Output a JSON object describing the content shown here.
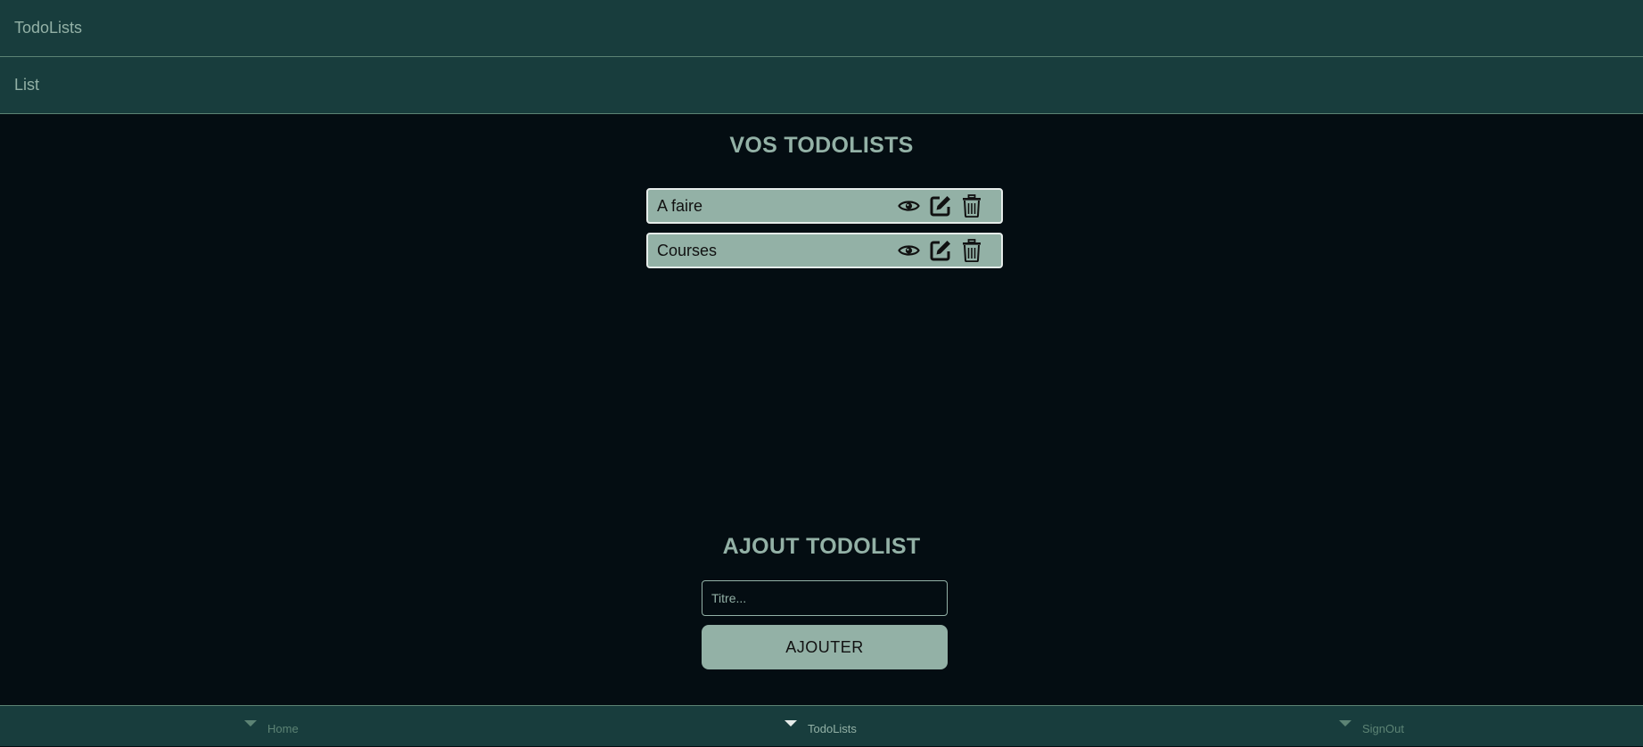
{
  "header": {
    "title": "TodoLists",
    "subtitle": "List"
  },
  "lists_section": {
    "title": "VOS TODOLISTS",
    "items": [
      {
        "label": "A faire",
        "icons": [
          "eye-icon",
          "edit-icon",
          "trash-icon"
        ]
      },
      {
        "label": "Courses",
        "icons": [
          "eye-icon",
          "edit-icon",
          "trash-icon"
        ]
      }
    ]
  },
  "add_section": {
    "title": "AJOUT TODOLIST",
    "input_placeholder": "Titre...",
    "input_value": "",
    "button_label": "AJOUTER"
  },
  "bottom_nav": {
    "items": [
      {
        "label": "Home",
        "icon": "caret-down-icon",
        "active": false
      },
      {
        "label": "TodoLists",
        "icon": "caret-down-icon",
        "active": true
      },
      {
        "label": "SignOut",
        "icon": "caret-down-icon",
        "active": false
      }
    ]
  },
  "colors": {
    "background": "#040d12",
    "bar": "#183d3d",
    "accent": "#93b1a6",
    "muted": "#5c8374"
  }
}
